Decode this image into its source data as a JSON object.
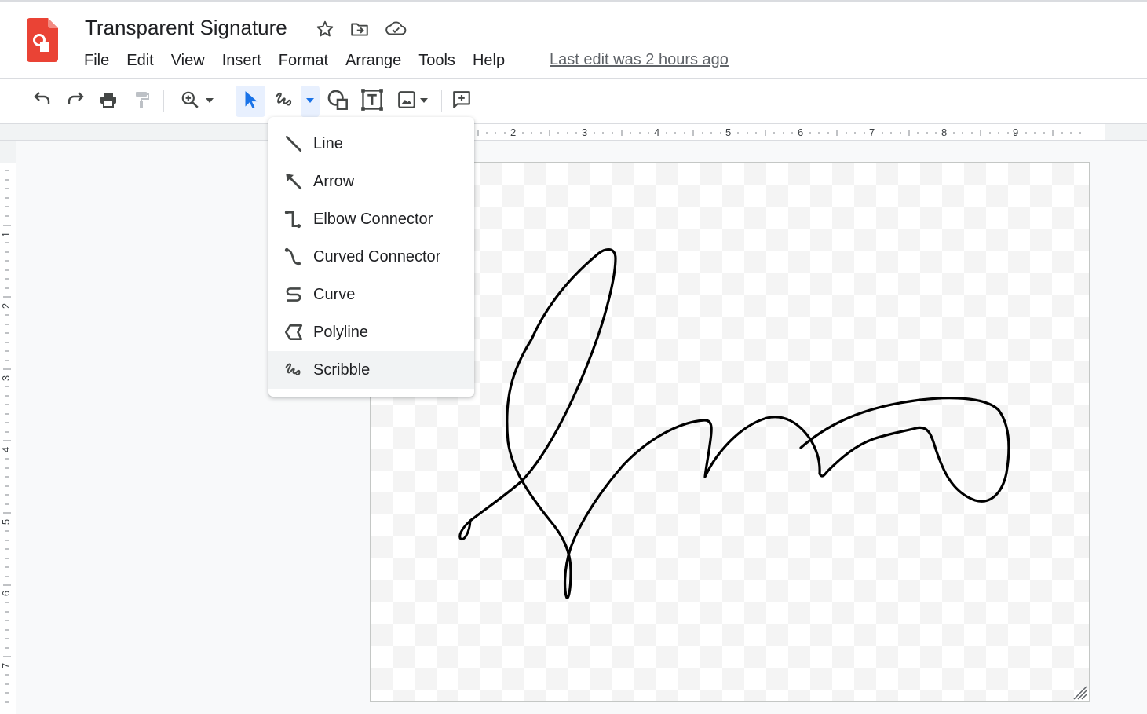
{
  "document": {
    "title": "Transparent Signature",
    "last_edit": "Last edit was 2 hours ago"
  },
  "menubar": {
    "items": [
      {
        "label": "File"
      },
      {
        "label": "Edit"
      },
      {
        "label": "View"
      },
      {
        "label": "Insert"
      },
      {
        "label": "Format"
      },
      {
        "label": "Arrange"
      },
      {
        "label": "Tools"
      },
      {
        "label": "Help"
      }
    ]
  },
  "toolbar": {
    "buttons": [
      "undo-icon",
      "redo-icon",
      "print-icon",
      "paint-format-icon",
      "zoom-icon",
      "select-icon",
      "scribble-icon",
      "shape-icon",
      "text-box-icon",
      "image-icon",
      "add-comment-icon"
    ],
    "active": "select"
  },
  "line_menu": {
    "items": [
      {
        "label": "Line",
        "icon": "line-icon"
      },
      {
        "label": "Arrow",
        "icon": "arrow-icon"
      },
      {
        "label": "Elbow Connector",
        "icon": "elbow-connector-icon"
      },
      {
        "label": "Curved Connector",
        "icon": "curved-connector-icon"
      },
      {
        "label": "Curve",
        "icon": "curve-icon"
      },
      {
        "label": "Polyline",
        "icon": "polyline-icon"
      },
      {
        "label": "Scribble",
        "icon": "scribble-icon"
      }
    ],
    "highlighted": "Scribble"
  },
  "rulers": {
    "horizontal": [
      "2",
      "3",
      "4",
      "5",
      "6",
      "7",
      "8",
      "9"
    ],
    "vertical": [
      "1",
      "2",
      "3",
      "4",
      "5",
      "6",
      "7"
    ]
  },
  "colors": {
    "accent": "#1a73e8",
    "active_bg": "#e8f0fe",
    "logo": "#ea4335",
    "text": "#202124",
    "icon": "#444746"
  }
}
